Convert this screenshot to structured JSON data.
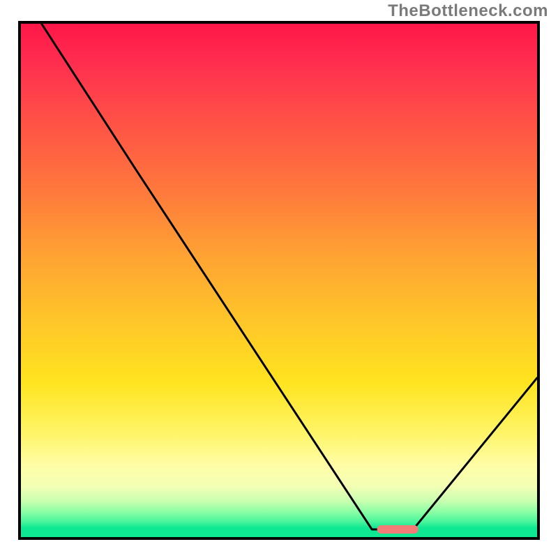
{
  "watermark": "TheBottleneck.com",
  "chart_data": {
    "type": "line",
    "title": "",
    "xlabel": "",
    "ylabel": "",
    "xlim": [
      0,
      100
    ],
    "ylim": [
      0,
      100
    ],
    "series": [
      {
        "name": "curve",
        "x": [
          4,
          22,
          68,
          76,
          100
        ],
        "y": [
          100,
          72,
          1.5,
          1.5,
          31
        ]
      }
    ],
    "marker": {
      "name": "target",
      "x_start": 69,
      "x_end": 77,
      "y": 1.5,
      "color": "#f37b78"
    },
    "gradient_stops": [
      {
        "pos": 0,
        "color": "#ff1648"
      },
      {
        "pos": 20,
        "color": "#ff5445"
      },
      {
        "pos": 45,
        "color": "#ffa233"
      },
      {
        "pos": 70,
        "color": "#ffe41f"
      },
      {
        "pos": 86,
        "color": "#fffda6"
      },
      {
        "pos": 95,
        "color": "#8effa6"
      },
      {
        "pos": 100,
        "color": "#0fe892"
      }
    ]
  }
}
